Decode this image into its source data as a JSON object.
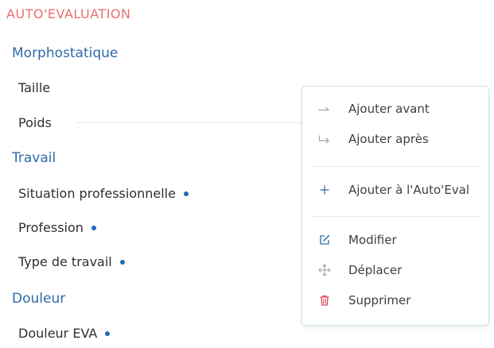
{
  "page": {
    "title": "AUTO'EVALUATION"
  },
  "sections": [
    {
      "title": "Morphostatique",
      "fields": [
        {
          "label": "Taille"
        },
        {
          "label": "Poids"
        }
      ]
    },
    {
      "title": "Travail",
      "fields": [
        {
          "label": "Situation professionnelle"
        },
        {
          "label": "Profession"
        },
        {
          "label": "Type de travail"
        }
      ]
    },
    {
      "title": "Douleur",
      "fields": [
        {
          "label": "Douleur EVA"
        }
      ]
    }
  ],
  "context_menu": {
    "items": [
      {
        "label": "Ajouter avant",
        "icon": "arrow-right-icon"
      },
      {
        "label": "Ajouter après",
        "icon": "arrow-turn-down-right-icon"
      },
      {
        "label": "Ajouter à l'Auto'Eval",
        "icon": "plus-icon"
      },
      {
        "label": "Modifier",
        "icon": "edit-icon"
      },
      {
        "label": "Déplacer",
        "icon": "move-icon"
      },
      {
        "label": "Supprimer",
        "icon": "trash-icon"
      }
    ]
  },
  "colors": {
    "title": "#e8706e",
    "section": "#2e6aa6",
    "dot": "#1f6cb5",
    "icon_blue": "#2e6aa6",
    "icon_grey": "#9aa3ad",
    "icon_red": "#e0475a"
  }
}
